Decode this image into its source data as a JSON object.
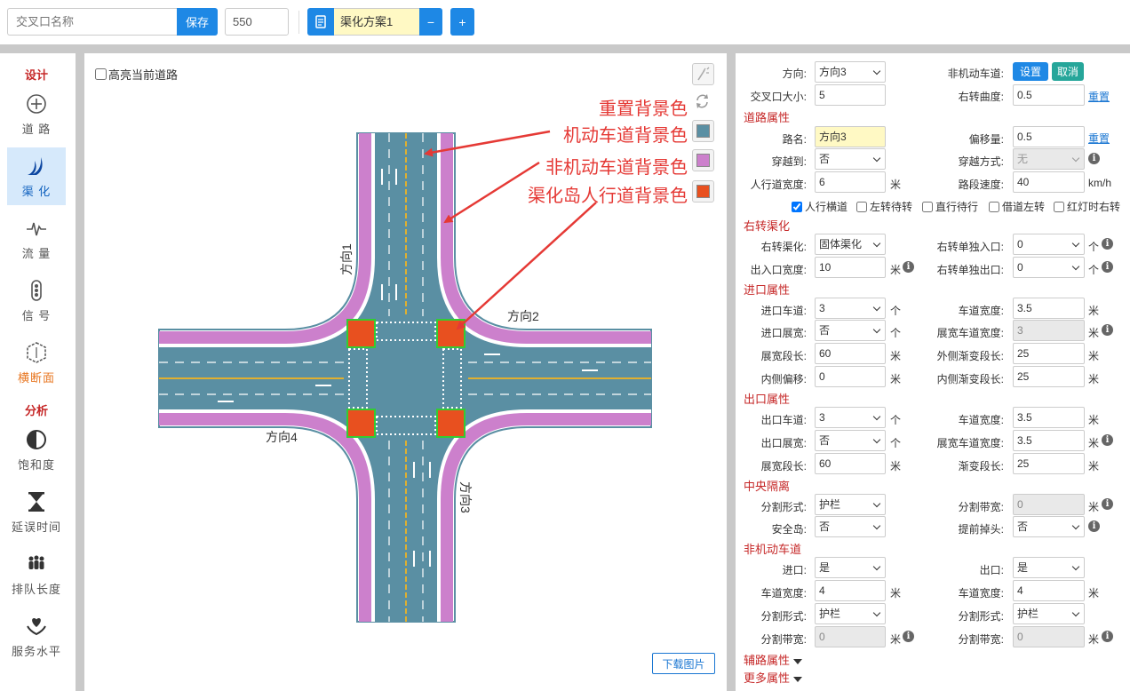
{
  "toolbar": {
    "name_placeholder": "交叉口名称",
    "save_label": "保存",
    "size_value": "550",
    "scheme_name": "渠化方案1",
    "minus_label": "−",
    "plus_label": "+"
  },
  "sidebar": {
    "design_title": "设计",
    "analysis_title": "分析",
    "items": [
      {
        "label": "道 路",
        "icon": "crosshair-icon"
      },
      {
        "label": "渠 化",
        "icon": "channelization-icon"
      },
      {
        "label": "流 量",
        "icon": "pulse-icon"
      },
      {
        "label": "信 号",
        "icon": "traffic-light-icon"
      },
      {
        "label": "横断面",
        "icon": "cross-section-icon"
      },
      {
        "label": "饱和度",
        "icon": "half-circle-icon"
      },
      {
        "label": "延误时间",
        "icon": "hourglass-icon"
      },
      {
        "label": "排队长度",
        "icon": "queue-people-icon"
      },
      {
        "label": "服务水平",
        "icon": "heart-hand-icon"
      }
    ]
  },
  "canvas": {
    "highlight_label": "高亮当前道路",
    "annotations": {
      "reset_bg": "重置背景色",
      "motor_bg": "机动车道背景色",
      "nonmotor_bg": "非机动车道背景色",
      "island_bg": "渠化岛人行道背景色"
    },
    "colors": {
      "road": "#5a8fa3",
      "bike_lane": "#cc80cc",
      "island": "#e8501f",
      "island_border": "#33cc33",
      "median": "#e0b030",
      "arrow": "#e53935"
    },
    "directions": {
      "d1": "方向1",
      "d2": "方向2",
      "d3": "方向3",
      "d4": "方向4"
    },
    "download_label": "下载图片"
  },
  "props": {
    "direction_label": "方向:",
    "direction_value": "方向3",
    "nonmotor_label": "非机动车道:",
    "set_label": "设置",
    "cancel_label": "取消",
    "size_label": "交叉口大小:",
    "size_value": "5",
    "curve_label": "右转曲度:",
    "curve_value": "0.5",
    "reset_label": "重置",
    "road_section": "道路属性",
    "roadname_label": "路名:",
    "roadname_value": "方向3",
    "offset_label": "偏移量:",
    "offset_value": "0.5",
    "cross_label": "穿越到:",
    "cross_value": "否",
    "crossmode_label": "穿越方式:",
    "crossmode_value": "无",
    "sidewalk_label": "人行道宽度:",
    "sidewalk_value": "6",
    "speed_label": "路段速度:",
    "speed_value": "40",
    "unit_m": "米",
    "unit_speed": "km/h",
    "unit_count": "个",
    "checks": [
      {
        "label": "人行横道",
        "checked": true
      },
      {
        "label": "左转待转",
        "checked": false
      },
      {
        "label": "直行待行",
        "checked": false
      },
      {
        "label": "借道左转",
        "checked": false
      },
      {
        "label": "红灯时右转",
        "checked": false
      }
    ],
    "right_section": "右转渠化",
    "right_mode_label": "右转渠化:",
    "right_mode_value": "固体渠化",
    "right_entry_label": "右转单独入口:",
    "right_entry_value": "0",
    "io_width_label": "出入口宽度:",
    "io_width_value": "10",
    "right_exit_label": "右转单独出口:",
    "right_exit_value": "0",
    "entry_section": "进口属性",
    "entry_lanes_label": "进口车道:",
    "entry_lanes_value": "3",
    "lane_width_label": "车道宽度:",
    "entry_lane_width_value": "3.5",
    "entry_widen_label": "进口展宽:",
    "entry_widen_value": "否",
    "widen_lane_width_label": "展宽车道宽度:",
    "entry_widen_lane_width_value": "3",
    "widen_len_label": "展宽段长:",
    "entry_widen_len_value": "60",
    "outer_taper_label": "外侧渐变段长:",
    "outer_taper_value": "25",
    "inner_offset_label": "内侧偏移:",
    "inner_offset_value": "0",
    "inner_taper_label": "内侧渐变段长:",
    "inner_taper_value": "25",
    "exit_section": "出口属性",
    "exit_lanes_label": "出口车道:",
    "exit_lanes_value": "3",
    "exit_lane_width_value": "3.5",
    "exit_widen_label": "出口展宽:",
    "exit_widen_value": "否",
    "exit_widen_lane_width_value": "3.5",
    "exit_widen_len_value": "60",
    "taper_label": "渐变段长:",
    "exit_taper_value": "25",
    "median_section": "中央隔离",
    "split_form_label": "分割形式:",
    "split_form_value": "护栏",
    "split_width_label": "分割带宽:",
    "split_width_value": "0",
    "island_label": "安全岛:",
    "island_value": "否",
    "uturn_label": "提前掉头:",
    "uturn_value": "否",
    "nonmotor_section": "非机动车道",
    "nm_entry_label": "进口:",
    "nm_entry_value": "是",
    "nm_exit_label": "出口:",
    "nm_exit_value": "是",
    "nm_lane_width_value": "4",
    "nm_exit_lane_width_value": "4",
    "nm_split_value": "护栏",
    "nm_exit_split_value": "护栏",
    "nm_split_width_value": "0",
    "nm_exit_split_width_value": "0",
    "aux_section": "辅路属性",
    "more_section": "更多属性"
  }
}
